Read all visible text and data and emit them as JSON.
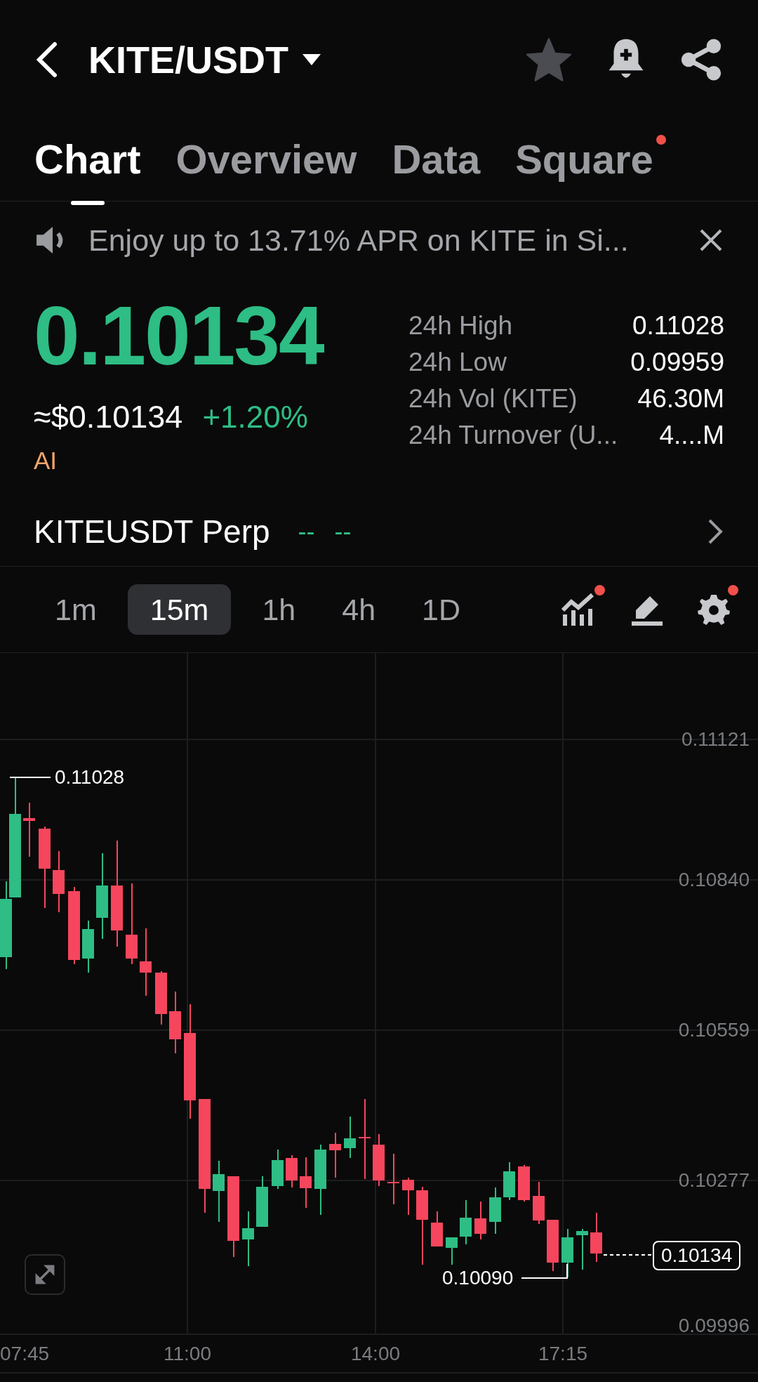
{
  "header": {
    "title": "KITE/USDT"
  },
  "tabs": [
    {
      "label": "Chart",
      "selected": true,
      "badge": false
    },
    {
      "label": "Overview",
      "selected": false,
      "badge": false
    },
    {
      "label": "Data",
      "selected": false,
      "badge": false
    },
    {
      "label": "Square",
      "selected": false,
      "badge": true
    }
  ],
  "banner": {
    "text": "Enjoy up to 13.71% APR on KITE in Si..."
  },
  "ticker": {
    "price": "0.10134",
    "usd_price": "≈$0.10134",
    "change": "+1.20%",
    "tag": "AI"
  },
  "stats": [
    {
      "label": "24h High",
      "value": "0.11028"
    },
    {
      "label": "24h Low",
      "value": "0.09959"
    },
    {
      "label": "24h Vol (KITE)",
      "value": "46.30M"
    },
    {
      "label": "24h Turnover (U...",
      "value": "4....M"
    }
  ],
  "perp": {
    "label": "KITEUSDT Perp",
    "price": "--",
    "change": "--"
  },
  "timeframes": [
    {
      "label": "1m",
      "selected": false
    },
    {
      "label": "15m",
      "selected": true
    },
    {
      "label": "1h",
      "selected": false
    },
    {
      "label": "4h",
      "selected": false
    },
    {
      "label": "1D",
      "selected": false
    }
  ],
  "tools": [
    {
      "kind": "indicators",
      "badge": true
    },
    {
      "kind": "draw"
    },
    {
      "kind": "settings",
      "badge": true
    }
  ],
  "chart": {
    "price_axis": [
      "0.11121",
      "0.10840",
      "0.10559",
      "0.10277",
      "0.09996"
    ],
    "time_axis": [
      "07:45",
      "11:00",
      "14:00",
      "17:15"
    ],
    "high_marker": "0.11028",
    "low_marker": "0.10090",
    "last_price": "0.10134"
  }
}
